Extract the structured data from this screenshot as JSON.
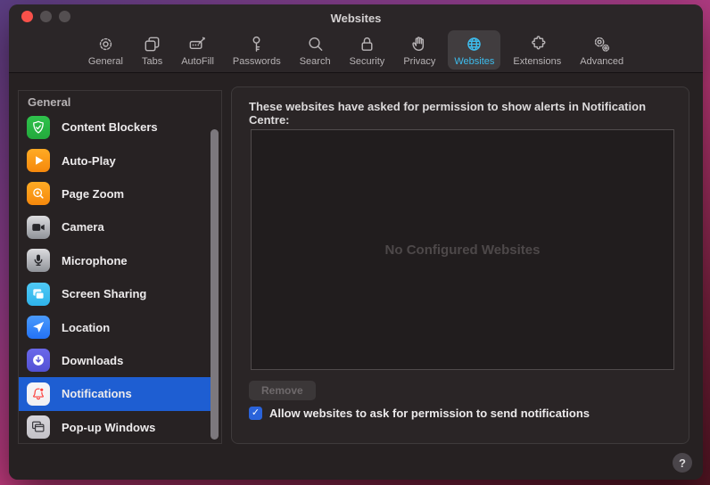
{
  "window": {
    "title": "Websites"
  },
  "toolbar": {
    "items": [
      {
        "label": "General",
        "icon": "gear-icon",
        "selected": false
      },
      {
        "label": "Tabs",
        "icon": "tabs-icon",
        "selected": false
      },
      {
        "label": "AutoFill",
        "icon": "autofill-icon",
        "selected": false
      },
      {
        "label": "Passwords",
        "icon": "key-icon",
        "selected": false
      },
      {
        "label": "Search",
        "icon": "search-icon",
        "selected": false
      },
      {
        "label": "Security",
        "icon": "lock-icon",
        "selected": false
      },
      {
        "label": "Privacy",
        "icon": "hand-icon",
        "selected": false
      },
      {
        "label": "Websites",
        "icon": "globe-icon",
        "selected": true
      },
      {
        "label": "Extensions",
        "icon": "puzzle-icon",
        "selected": false
      },
      {
        "label": "Advanced",
        "icon": "gears-icon",
        "selected": false
      }
    ]
  },
  "sidebar": {
    "header": "General",
    "items": [
      {
        "label": "Content Blockers",
        "icon": "shield-check-icon",
        "bg": "#2fc24c",
        "bg2": "#23a93c",
        "selected": false
      },
      {
        "label": "Auto-Play",
        "icon": "play-icon",
        "bg": "#ffab24",
        "bg2": "#f5880c",
        "selected": false
      },
      {
        "label": "Page Zoom",
        "icon": "zoom-plus-icon",
        "bg": "#ffab24",
        "bg2": "#f5880c",
        "selected": false
      },
      {
        "label": "Camera",
        "icon": "video-camera-icon",
        "bg": "#dcdcdf",
        "bg2": "#909399",
        "selected": false
      },
      {
        "label": "Microphone",
        "icon": "microphone-icon",
        "bg": "#dcdcdf",
        "bg2": "#909399",
        "selected": false
      },
      {
        "label": "Screen Sharing",
        "icon": "screens-icon",
        "bg": "#4fc9f5",
        "bg2": "#2fb3ea",
        "selected": false
      },
      {
        "label": "Location",
        "icon": "location-arrow-icon",
        "bg": "#4a9bfc",
        "bg2": "#2472f5",
        "selected": false
      },
      {
        "label": "Downloads",
        "icon": "download-circle-icon",
        "bg": "#6a68ea",
        "bg2": "#5351d4",
        "selected": false
      },
      {
        "label": "Notifications",
        "icon": "bell-icon",
        "bg": "#f7f6f8",
        "bg2": "#f0eff2",
        "selected": true
      },
      {
        "label": "Pop-up Windows",
        "icon": "popup-windows-icon",
        "bg": "#d7d5da",
        "bg2": "#c3c1c7",
        "selected": false
      }
    ]
  },
  "main": {
    "description": "These websites have asked for permission to show alerts in Notification Centre:",
    "empty_state": "No Configured Websites",
    "remove_label": "Remove",
    "checkbox": {
      "label": "Allow websites to ask for permission to send notifications",
      "checked": true
    },
    "help_label": "?"
  },
  "colors": {
    "selected_row_blue": "#1e5ed2",
    "toolbar_selected_cyan": "#3dbdee",
    "checkbox_blue": "#2a63da",
    "window_bg": "#262122",
    "traffic_red": "#f8514a",
    "bell_red": "#fc3d39"
  }
}
